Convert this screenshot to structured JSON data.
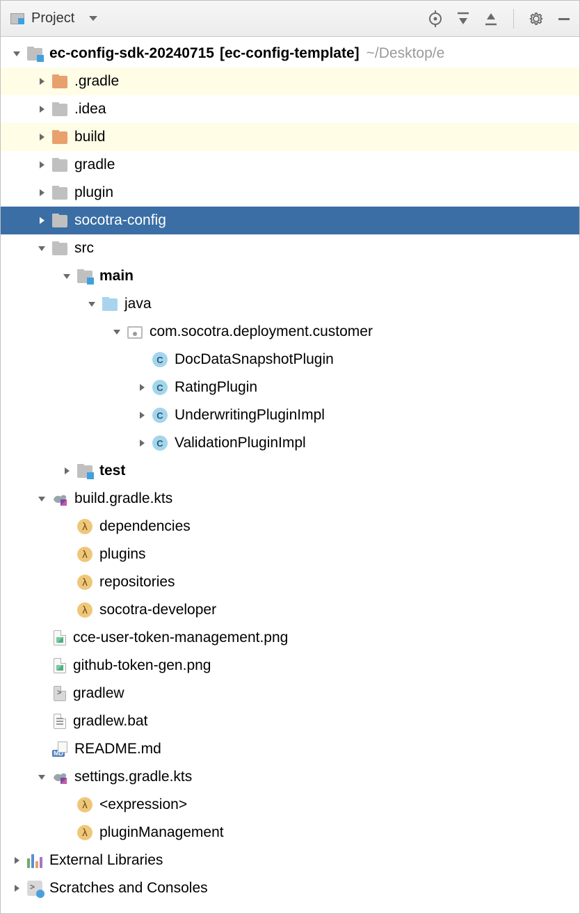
{
  "header": {
    "title": "Project"
  },
  "root": {
    "name": "ec-config-sdk-20240715",
    "repo": "[ec-config-template]",
    "path": "~/Desktop/e"
  },
  "items": {
    "gradleDot": ".gradle",
    "idea": ".idea",
    "build": "build",
    "gradle": "gradle",
    "plugin": "plugin",
    "socotra": "socotra-config",
    "src": "src",
    "main": "main",
    "java": "java",
    "pkg": "com.socotra.deployment.customer",
    "c1": "DocDataSnapshotPlugin",
    "c2": "RatingPlugin",
    "c3": "UnderwritingPluginImpl",
    "c4": "ValidationPluginImpl",
    "test": "test",
    "bgk": "build.gradle.kts",
    "dep": "dependencies",
    "plg": "plugins",
    "rep": "repositories",
    "sdev": "socotra-developer",
    "png1": "cce-user-token-management.png",
    "png2": "github-token-gen.png",
    "gw": "gradlew",
    "gwb": "gradlew.bat",
    "readme": "README.md",
    "sgk": "settings.gradle.kts",
    "expr": "<expression>",
    "pmgmt": "pluginManagement",
    "ext": "External Libraries",
    "scr": "Scratches and Consoles"
  }
}
